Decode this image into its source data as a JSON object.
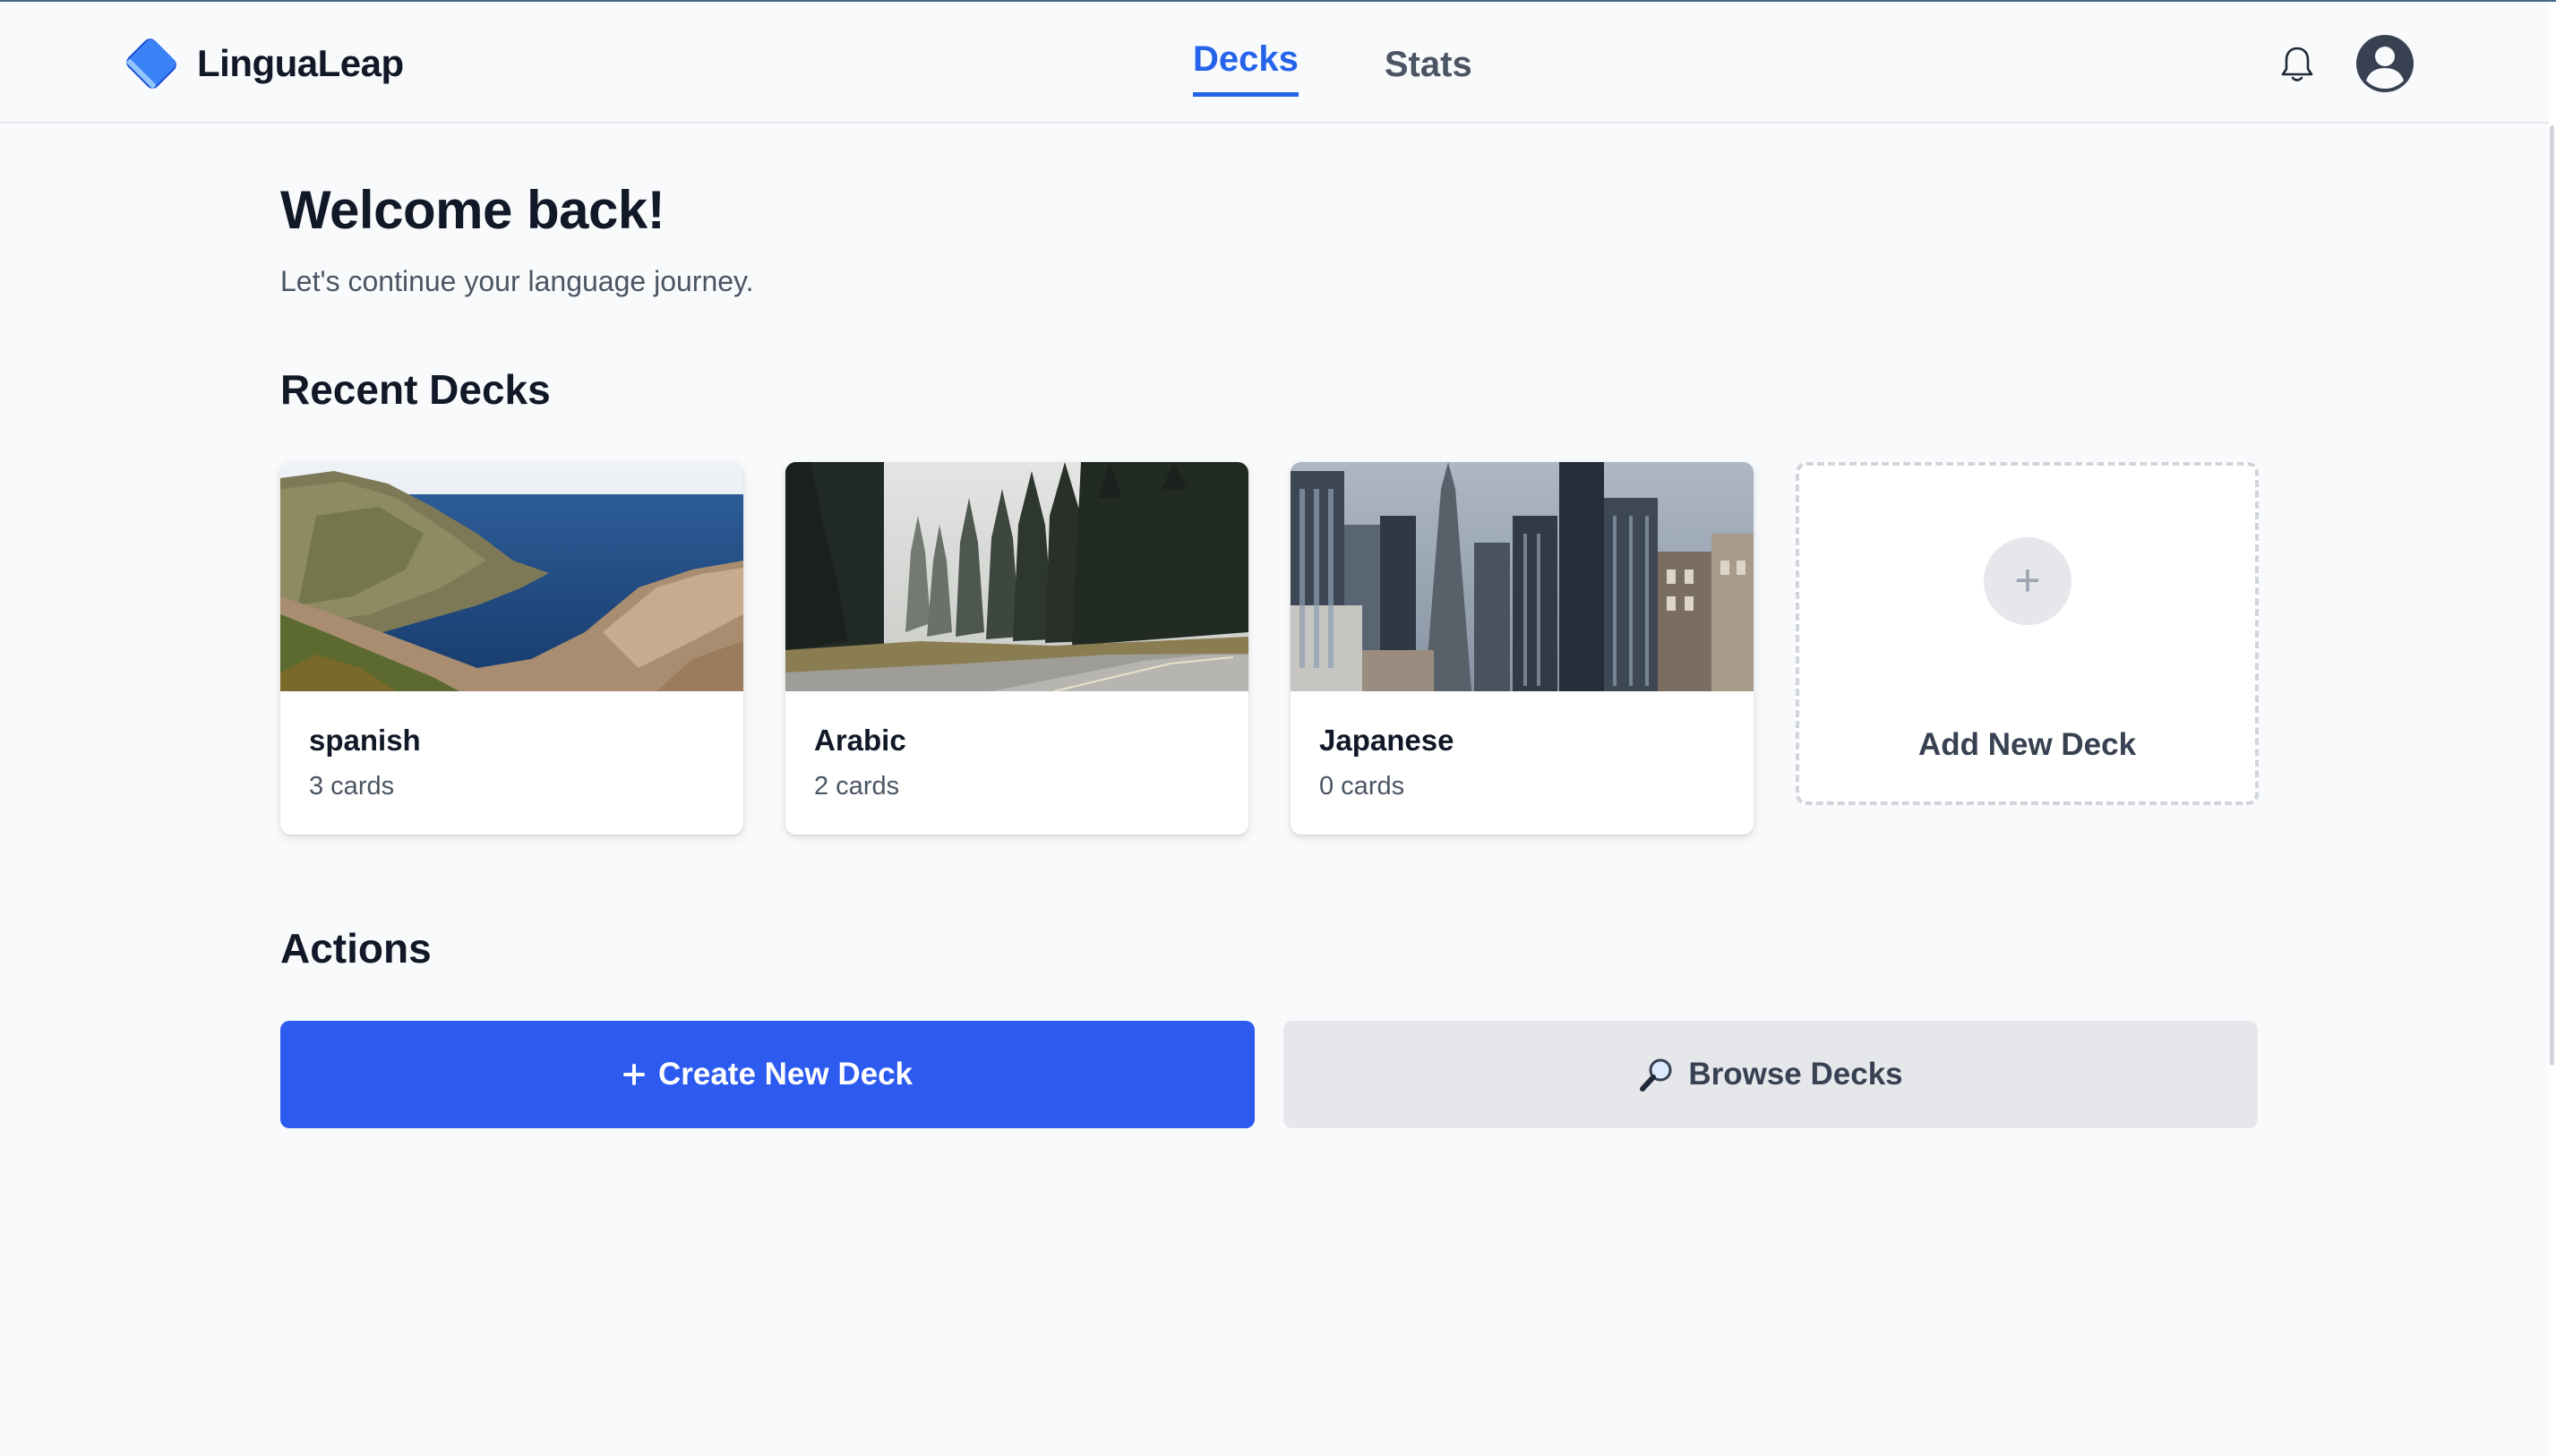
{
  "app": {
    "name": "LinguaLeap"
  },
  "nav": {
    "tabs": [
      {
        "label": "Decks",
        "active": true
      },
      {
        "label": "Stats",
        "active": false
      }
    ]
  },
  "header": {
    "icons": [
      "bell-icon",
      "user-avatar-icon"
    ]
  },
  "welcome": {
    "title": "Welcome back!",
    "subtitle": "Let's continue your language journey."
  },
  "recent": {
    "title": "Recent Decks",
    "decks": [
      {
        "name": "spanish",
        "count": "3 cards",
        "image": "coastal-cliffs-sea"
      },
      {
        "name": "Arabic",
        "count": "2 cards",
        "image": "forest-road"
      },
      {
        "name": "Japanese",
        "count": "0 cards",
        "image": "city-skyline"
      }
    ],
    "add_label": "Add New Deck"
  },
  "actions": {
    "title": "Actions",
    "create_label": "Create New Deck",
    "browse_label": "Browse Decks"
  },
  "colors": {
    "accent": "#2563eb",
    "primary_button": "#2d5bef",
    "secondary_button": "#e5e7eb",
    "background": "#f8fafc"
  }
}
